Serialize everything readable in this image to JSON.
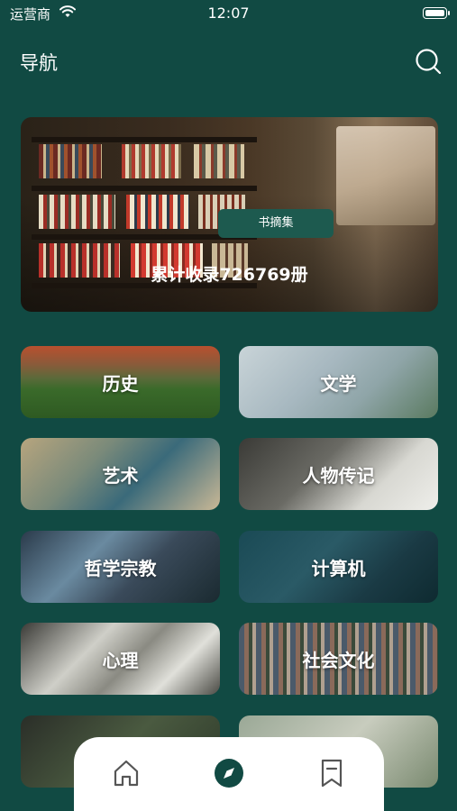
{
  "status_bar": {
    "carrier": "运营商",
    "time": "12:07"
  },
  "header": {
    "title": "导航",
    "search_icon": "search-icon"
  },
  "banner": {
    "tag": "书摘集",
    "stat": "累计收录726769册"
  },
  "categories": [
    {
      "label": "历史"
    },
    {
      "label": "文学"
    },
    {
      "label": "艺术"
    },
    {
      "label": "人物传记"
    },
    {
      "label": "哲学宗教"
    },
    {
      "label": "计算机"
    },
    {
      "label": "心理"
    },
    {
      "label": "社会文化"
    },
    {
      "label": ""
    },
    {
      "label": ""
    }
  ],
  "tab_bar": {
    "items": [
      {
        "icon": "home-icon",
        "active": false
      },
      {
        "icon": "compass-icon",
        "active": true
      },
      {
        "icon": "bookmark-icon",
        "active": false
      }
    ],
    "active_color": "#114a43",
    "inactive_color": "#555555"
  },
  "colors": {
    "background": "#114a43",
    "tag": "#1d5a4f"
  }
}
